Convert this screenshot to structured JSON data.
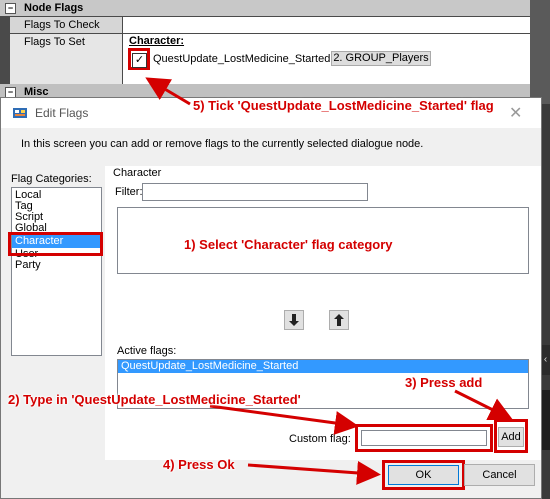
{
  "property_grid": {
    "node_flags_label": "Node Flags",
    "flags_to_check_label": "Flags To Check",
    "flags_to_set_label": "Flags To Set",
    "character_label": "Character:",
    "flag_name": "QuestUpdate_LostMedicine_Started",
    "flag_checked": true,
    "group_label": "2. GROUP_Players",
    "misc_label": "Misc"
  },
  "dialog": {
    "title": "Edit Flags",
    "description": "In this screen you can add or remove flags to the currently selected dialogue node.",
    "categories_label": "Flag Categories:",
    "categories": [
      "Local",
      "Tag",
      "Script",
      "Global",
      "Character",
      "User",
      "Party"
    ],
    "selected_category": "Character",
    "group_title": "Character",
    "filter_label": "Filter:",
    "filter_value": "",
    "move_down_icon": "arrow-down-icon",
    "move_up_icon": "arrow-up-icon",
    "active_flags_label": "Active flags:",
    "active_flags": [
      "QuestUpdate_LostMedicine_Started"
    ],
    "custom_flag_label": "Custom flag:",
    "custom_flag_value": "",
    "add_label": "Add",
    "ok_label": "OK",
    "cancel_label": "Cancel"
  },
  "annotations": {
    "step1": "1) Select 'Character' flag category",
    "step2": "2) Type in 'QuestUpdate_LostMedicine_Started'",
    "step3": "3) Press add",
    "step4": "4) Press Ok",
    "step5": "5) Tick 'QuestUpdate_LostMedicine_Started' flag",
    "color": "#d40000"
  }
}
